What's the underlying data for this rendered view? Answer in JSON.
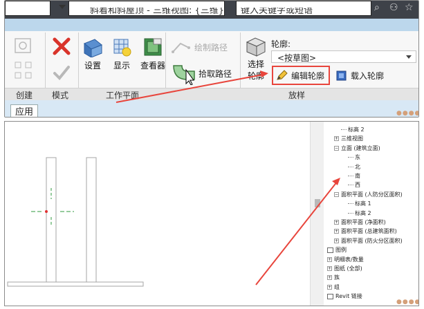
{
  "titlebar": {
    "title": "斜着和斜屋顶 - 三维视图: {三维}",
    "search_placeholder": "键入关键字或短语"
  },
  "ribbon": {
    "groups": {
      "create": "创建",
      "mode": "模式",
      "work_plane": "工作平面",
      "sweep": "放样"
    },
    "buttons": {
      "set": "设置",
      "show": "显示",
      "viewer": "查看器",
      "draw_path": "绘制路径",
      "pick_path": "拾取路径",
      "select_profile_line1": "选择",
      "select_profile_line2": "轮廓",
      "edit_profile": "编辑轮廓",
      "load_profile": "载入轮廓"
    },
    "profile_label": "轮廓:",
    "profile_value": "<按草图>",
    "apply_tab": "应用"
  },
  "browser": {
    "items": [
      {
        "label": "标高 2",
        "indent": 2,
        "exp": ""
      },
      {
        "label": "三维视图",
        "indent": 1,
        "exp": "+"
      },
      {
        "label": "立面 (建筑立面)",
        "indent": 1,
        "exp": "−"
      },
      {
        "label": "东",
        "indent": 3,
        "exp": ""
      },
      {
        "label": "北",
        "indent": 3,
        "exp": ""
      },
      {
        "label": "南",
        "indent": 3,
        "exp": ""
      },
      {
        "label": "西",
        "indent": 3,
        "exp": ""
      },
      {
        "label": "面积平面 (人防分区面积)",
        "indent": 1,
        "exp": "−"
      },
      {
        "label": "标高 1",
        "indent": 3,
        "exp": ""
      },
      {
        "label": "标高 2",
        "indent": 3,
        "exp": ""
      },
      {
        "label": "面积平面 (净面积)",
        "indent": 1,
        "exp": "+"
      },
      {
        "label": "面积平面 (总建筑面积)",
        "indent": 1,
        "exp": "+"
      },
      {
        "label": "面积平面 (防火分区面积)",
        "indent": 1,
        "exp": "+"
      },
      {
        "label": "图例",
        "indent": 0,
        "exp": ""
      },
      {
        "label": "明细表/数量",
        "indent": 0,
        "exp": "+"
      },
      {
        "label": "图纸 (全部)",
        "indent": 0,
        "exp": "+"
      },
      {
        "label": "族",
        "indent": 0,
        "exp": "+"
      },
      {
        "label": "组",
        "indent": 0,
        "exp": "+"
      },
      {
        "label": "Revit 链接",
        "indent": 0,
        "exp": ""
      }
    ]
  },
  "colors": {
    "annotation_red": "#e8453c",
    "titlebar": "#3e4249",
    "ribbon_band": "#bcd7ec"
  }
}
